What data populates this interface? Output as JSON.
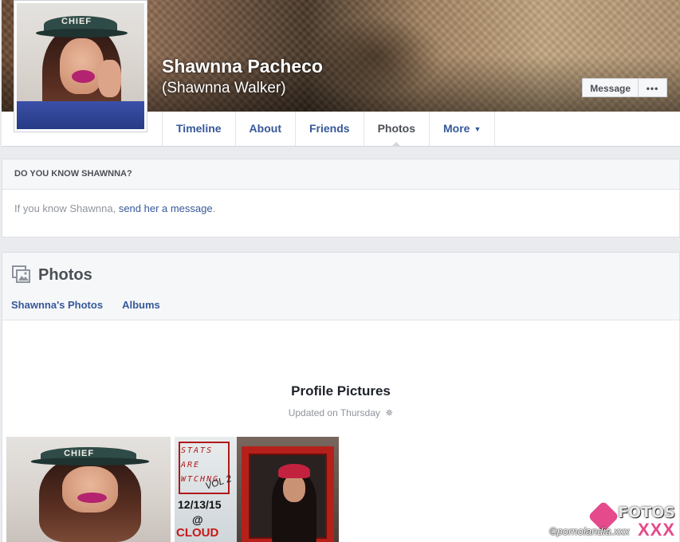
{
  "profile": {
    "name": "Shawnna Pacheco",
    "alt_name": "(Shawnna Walker)",
    "cap_text": "CHIEF"
  },
  "actions": {
    "message_label": "Message",
    "more_label": "•••"
  },
  "nav": {
    "tabs": [
      {
        "label": "Timeline"
      },
      {
        "label": "About"
      },
      {
        "label": "Friends"
      },
      {
        "label": "Photos",
        "active": true
      },
      {
        "label": "More",
        "caret": "▼"
      }
    ]
  },
  "know": {
    "heading": "DO YOU KNOW SHAWNNA?",
    "text_prefix": "If you know Shawnna, ",
    "link": "send her a message",
    "text_suffix": "."
  },
  "photos": {
    "title": "Photos",
    "subtabs": [
      {
        "label": "Shawnna's Photos"
      },
      {
        "label": "Albums"
      }
    ],
    "album": {
      "title": "Profile Pictures",
      "updated": "Updated on Thursday",
      "gear_icon": "✵"
    },
    "flyer": {
      "words": [
        "STATS",
        "ARE",
        "WTCHNG"
      ],
      "vol": "VOL 2",
      "date": "12/13/15",
      "at": "@",
      "venue": "CLOUD"
    }
  },
  "watermark": {
    "brand": "FOTOS",
    "xxx": "XXX",
    "site": "©pornolandia.xxx"
  },
  "colors": {
    "link": "#365899",
    "page_bg": "#e9ebee",
    "muted": "#90949c"
  }
}
